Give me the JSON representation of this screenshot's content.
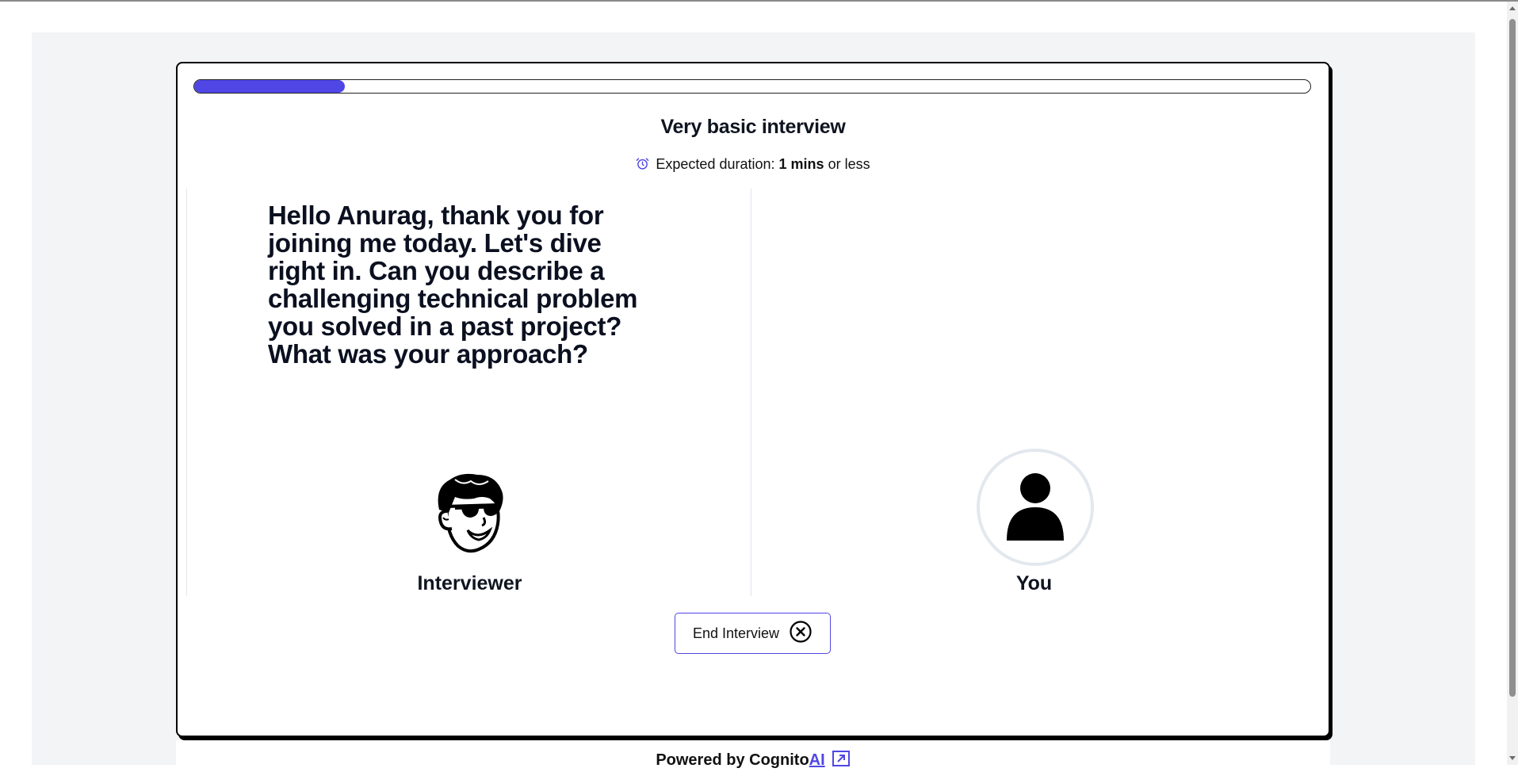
{
  "interview": {
    "title": "Very basic interview",
    "progress_fraction": 0.135,
    "duration_prefix": "Expected duration:",
    "duration_value": "1 mins",
    "duration_suffix": "or less"
  },
  "interviewer": {
    "question": "Hello Anurag, thank you for joining me today. Let's dive right in. Can you describe a challenging technical problem you solved in a past project? What was your approach?",
    "label": "Interviewer",
    "avatar_icon": "cartoon-face-with-sunglasses-icon"
  },
  "candidate": {
    "label": "You",
    "avatar_icon": "person-icon"
  },
  "actions": {
    "end_label": "End Interview",
    "end_icon": "close-circle-icon"
  },
  "footer": {
    "powered_by": "Powered by",
    "brand_main": "Cognito",
    "brand_accent": "AI",
    "link_icon": "external-link-icon"
  },
  "colors": {
    "accent": "#4f46e5",
    "page_bg": "#f3f4f6",
    "border": "#000000"
  }
}
